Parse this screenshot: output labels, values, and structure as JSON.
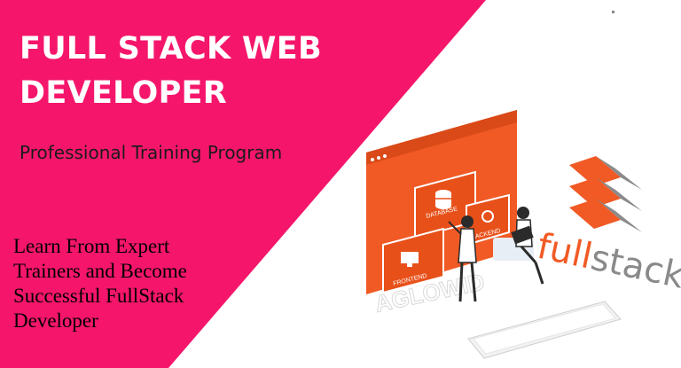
{
  "banner": {
    "title_line1": "FULL STACK WEB",
    "title_line2": "DEVELOPER",
    "subtitle": "Professional Training Program",
    "tagline_line1": "Learn From Expert",
    "tagline_line2": "Trainers and Become",
    "tagline_line3": "Successful FullStack",
    "tagline_line4": "Developer"
  },
  "illustration": {
    "logo_text_full": "full",
    "logo_text_stack": "stack",
    "screen_database": "DATABASE",
    "screen_backend": "BACKEND",
    "screen_frontend": "FRONTEND",
    "watermark": "AGLOWID"
  },
  "colors": {
    "brand_pink": "#F5166B",
    "accent_orange": "#F15A24",
    "logo_gray": "#8A8A8A"
  }
}
